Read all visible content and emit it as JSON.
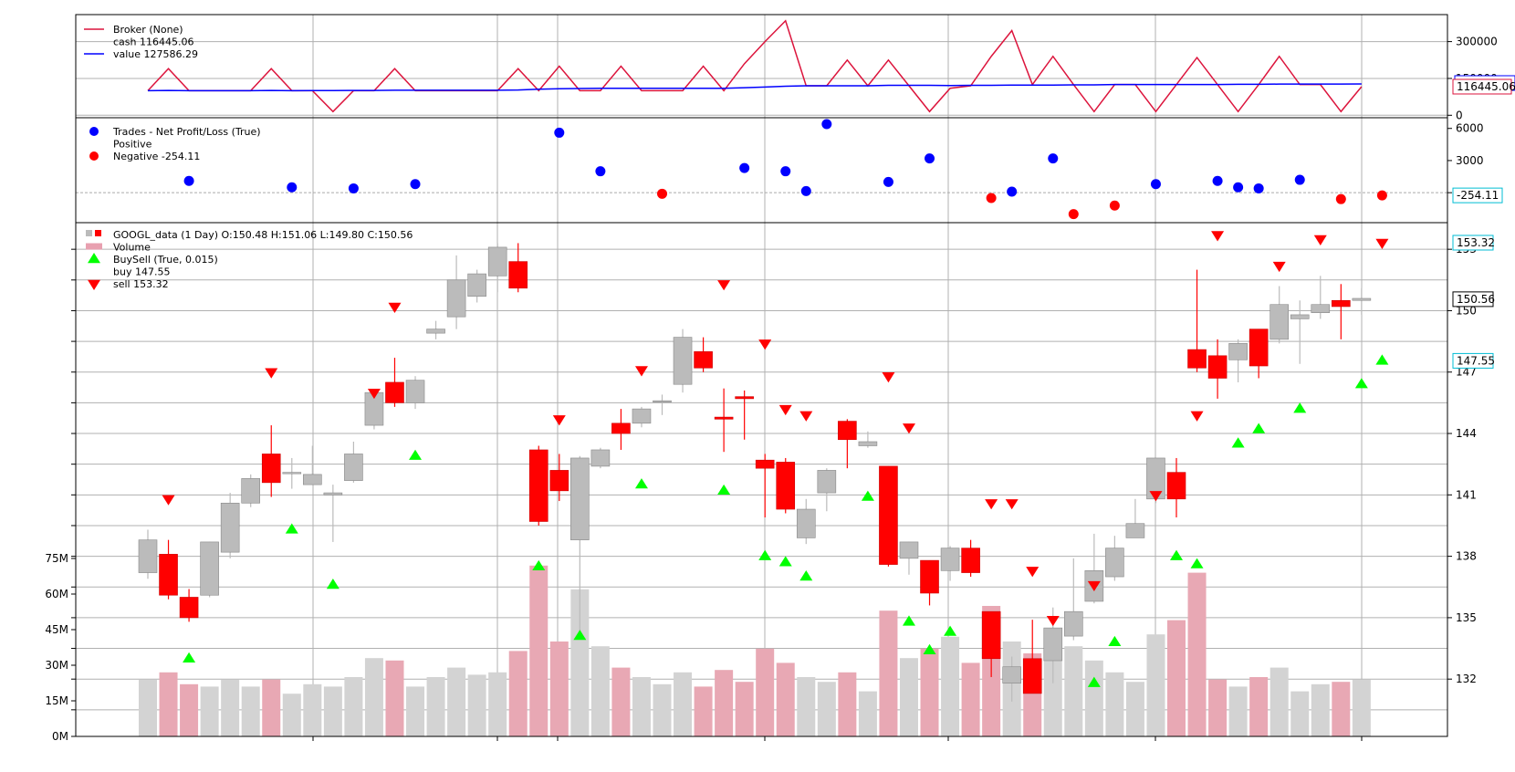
{
  "chart_data": [
    {
      "panel": "broker",
      "type": "line",
      "legend": {
        "title": "Broker (None)",
        "entries": [
          {
            "label": "cash 116445.06",
            "color": "#dc143c"
          },
          {
            "label": "value 127586.29",
            "color": "#0000ff"
          }
        ]
      },
      "yticks": [
        "0",
        "150000",
        "300000"
      ],
      "ylim": [
        -10000,
        410000
      ],
      "last_label": "116445.06",
      "cash": [
        100000,
        190000,
        100000,
        100000,
        100000,
        100000,
        190000,
        100000,
        100000,
        15000,
        100000,
        100000,
        190000,
        100000,
        100000,
        100000,
        100000,
        100000,
        190000,
        100000,
        200000,
        100000,
        100000,
        200000,
        100000,
        100000,
        100000,
        200000,
        100000,
        210000,
        300000,
        385000,
        120000,
        120000,
        225000,
        120000,
        225000,
        120000,
        15000,
        110000,
        120000,
        240000,
        345000,
        125000,
        240000,
        125000,
        15000,
        125000,
        125000,
        15000,
        125000,
        235000,
        125000,
        15000,
        125000,
        240000,
        125000,
        125000,
        15000,
        116445
      ],
      "value": [
        100000,
        101000,
        100000,
        100000,
        100000,
        100000,
        101000,
        100000,
        100500,
        100500,
        101000,
        101000,
        102000,
        102000,
        102000,
        102000,
        102000,
        102000,
        103000,
        106000,
        108000,
        109000,
        110000,
        110000,
        110000,
        110000,
        110000,
        110000,
        110000,
        112000,
        115000,
        118000,
        120000,
        120000,
        120000,
        120000,
        122000,
        122000,
        122000,
        121000,
        122000,
        122000,
        123000,
        123000,
        123000,
        124000,
        124000,
        125000,
        125000,
        125000,
        125000,
        125000,
        125000,
        126000,
        126000,
        127000,
        127000,
        127000,
        127000,
        127586
      ]
    },
    {
      "panel": "trades",
      "type": "scatter",
      "legend": {
        "title": "Trades - Net Profit/Loss (True)",
        "entries": [
          {
            "label": "Positive",
            "color": "#0000ff"
          },
          {
            "label": "Negative -254.11",
            "color": "#ff0000"
          }
        ]
      },
      "yticks": [
        "0",
        "3000",
        "6000"
      ],
      "ylim": [
        -2800,
        7000
      ],
      "last_label": "-254.11",
      "points": [
        {
          "i": 2,
          "v": 1100,
          "sign": "positive"
        },
        {
          "i": 7,
          "v": 500,
          "sign": "positive"
        },
        {
          "i": 10,
          "v": 400,
          "sign": "positive"
        },
        {
          "i": 13,
          "v": 800,
          "sign": "positive"
        },
        {
          "i": 20,
          "v": 5600,
          "sign": "positive"
        },
        {
          "i": 22,
          "v": 2000,
          "sign": "positive"
        },
        {
          "i": 25,
          "v": -100,
          "sign": "negative"
        },
        {
          "i": 29,
          "v": 2300,
          "sign": "positive"
        },
        {
          "i": 31,
          "v": 2000,
          "sign": "positive"
        },
        {
          "i": 32,
          "v": 150,
          "sign": "positive"
        },
        {
          "i": 33,
          "v": 6400,
          "sign": "positive"
        },
        {
          "i": 36,
          "v": 1000,
          "sign": "positive"
        },
        {
          "i": 38,
          "v": 3200,
          "sign": "positive"
        },
        {
          "i": 41,
          "v": -500,
          "sign": "negative"
        },
        {
          "i": 42,
          "v": 100,
          "sign": "positive"
        },
        {
          "i": 44,
          "v": 3200,
          "sign": "positive"
        },
        {
          "i": 45,
          "v": -2000,
          "sign": "negative"
        },
        {
          "i": 47,
          "v": -1200,
          "sign": "negative"
        },
        {
          "i": 49,
          "v": 800,
          "sign": "positive"
        },
        {
          "i": 52,
          "v": 1100,
          "sign": "positive"
        },
        {
          "i": 53,
          "v": 500,
          "sign": "positive"
        },
        {
          "i": 54,
          "v": 400,
          "sign": "positive"
        },
        {
          "i": 56,
          "v": 1200,
          "sign": "positive"
        },
        {
          "i": 58,
          "v": -600,
          "sign": "negative"
        },
        {
          "i": 60,
          "v": -254,
          "sign": "negative"
        }
      ]
    },
    {
      "panel": "price",
      "type": "candlestick",
      "legend": {
        "title": "GOOGL_data (1 Day) O:150.48 H:151.06 L:149.80 C:150.56",
        "entries": [
          {
            "label": "Volume",
            "color": "#e8a0b0"
          },
          {
            "label": "BuySell (True, 0.015)",
            "color": "#00ff00"
          },
          {
            "label": "buy 147.55",
            "color": "#00ff00"
          },
          {
            "label": "sell 153.32",
            "color": "#ff0000"
          }
        ]
      },
      "price_ticks": [
        "132",
        "135",
        "138",
        "141",
        "144",
        "147",
        "150",
        "153"
      ],
      "volume_ticks": [
        "0M",
        "15M",
        "30M",
        "45M",
        "60M",
        "75M"
      ],
      "price_ylim": [
        129.2,
        154.3
      ],
      "volume_max_m": 75,
      "price_labels": [
        "153.32",
        "150.56",
        "147.55"
      ],
      "candles": [
        {
          "o": 137.2,
          "h": 139.3,
          "l": 136.9,
          "c": 138.8
        },
        {
          "o": 138.1,
          "h": 138.8,
          "l": 135.9,
          "c": 136.1
        },
        {
          "o": 136.0,
          "h": 136.4,
          "l": 134.8,
          "c": 135.0
        },
        {
          "o": 136.1,
          "h": 138.7,
          "l": 136.0,
          "c": 138.7
        },
        {
          "o": 138.2,
          "h": 141.1,
          "l": 137.9,
          "c": 140.6
        },
        {
          "o": 140.6,
          "h": 142.0,
          "l": 140.4,
          "c": 141.8
        },
        {
          "o": 143.0,
          "h": 144.4,
          "l": 140.9,
          "c": 141.6
        },
        {
          "o": 142.1,
          "h": 142.8,
          "l": 141.3,
          "c": 142.1
        },
        {
          "o": 141.5,
          "h": 143.4,
          "l": 141.5,
          "c": 142.0
        },
        {
          "o": 141.0,
          "h": 141.5,
          "l": 138.7,
          "c": 141.1
        },
        {
          "o": 141.7,
          "h": 143.6,
          "l": 141.6,
          "c": 143.0
        },
        {
          "o": 144.4,
          "h": 146.1,
          "l": 144.2,
          "c": 146.0
        },
        {
          "o": 146.5,
          "h": 147.7,
          "l": 145.3,
          "c": 145.5
        },
        {
          "o": 145.5,
          "h": 146.8,
          "l": 145.2,
          "c": 146.6
        },
        {
          "o": 148.9,
          "h": 149.5,
          "l": 148.6,
          "c": 149.1
        },
        {
          "o": 149.7,
          "h": 152.7,
          "l": 149.1,
          "c": 151.5
        },
        {
          "o": 150.7,
          "h": 152.0,
          "l": 150.4,
          "c": 151.8
        },
        {
          "o": 151.7,
          "h": 153.3,
          "l": 150.9,
          "c": 153.1
        },
        {
          "o": 152.4,
          "h": 153.3,
          "l": 150.9,
          "c": 151.1
        },
        {
          "o": 143.2,
          "h": 143.4,
          "l": 139.5,
          "c": 139.7
        },
        {
          "o": 142.2,
          "h": 143.0,
          "l": 140.7,
          "c": 141.2
        },
        {
          "o": 138.8,
          "h": 142.9,
          "l": 134.1,
          "c": 142.8
        },
        {
          "o": 142.4,
          "h": 143.3,
          "l": 142.3,
          "c": 143.2
        },
        {
          "o": 144.5,
          "h": 145.2,
          "l": 143.2,
          "c": 144.0
        },
        {
          "o": 144.5,
          "h": 145.3,
          "l": 144.3,
          "c": 145.2
        },
        {
          "o": 145.6,
          "h": 145.9,
          "l": 144.9,
          "c": 145.6
        },
        {
          "o": 146.4,
          "h": 149.1,
          "l": 146.0,
          "c": 148.7
        },
        {
          "o": 148.0,
          "h": 148.7,
          "l": 147.0,
          "c": 147.2
        },
        {
          "o": 144.8,
          "h": 146.2,
          "l": 143.1,
          "c": 144.7
        },
        {
          "o": 145.8,
          "h": 146.1,
          "l": 143.7,
          "c": 145.7
        },
        {
          "o": 142.7,
          "h": 143.0,
          "l": 139.9,
          "c": 142.3
        },
        {
          "o": 142.6,
          "h": 142.8,
          "l": 140.1,
          "c": 140.3
        },
        {
          "o": 138.9,
          "h": 140.8,
          "l": 138.6,
          "c": 140.3
        },
        {
          "o": 141.1,
          "h": 142.3,
          "l": 140.2,
          "c": 142.2
        },
        {
          "o": 144.6,
          "h": 144.7,
          "l": 142.3,
          "c": 143.7
        },
        {
          "o": 143.4,
          "h": 144.1,
          "l": 143.3,
          "c": 143.6
        },
        {
          "o": 142.4,
          "h": 142.4,
          "l": 137.5,
          "c": 137.6
        },
        {
          "o": 137.9,
          "h": 138.7,
          "l": 137.1,
          "c": 138.7
        },
        {
          "o": 137.8,
          "h": 137.8,
          "l": 135.6,
          "c": 136.2
        },
        {
          "o": 137.3,
          "h": 138.5,
          "l": 136.8,
          "c": 138.4
        },
        {
          "o": 138.4,
          "h": 138.8,
          "l": 137.0,
          "c": 137.2
        },
        {
          "o": 135.3,
          "h": 135.3,
          "l": 132.1,
          "c": 133.0
        },
        {
          "o": 131.8,
          "h": 133.1,
          "l": 130.9,
          "c": 132.6
        },
        {
          "o": 133.0,
          "h": 134.9,
          "l": 131.5,
          "c": 131.3
        },
        {
          "o": 132.9,
          "h": 135.5,
          "l": 131.8,
          "c": 134.5
        },
        {
          "o": 134.1,
          "h": 137.9,
          "l": 133.9,
          "c": 135.3
        },
        {
          "o": 135.8,
          "h": 139.1,
          "l": 135.7,
          "c": 137.3
        },
        {
          "o": 137.0,
          "h": 139.0,
          "l": 136.8,
          "c": 138.4
        },
        {
          "o": 138.9,
          "h": 140.8,
          "l": 138.9,
          "c": 139.6
        },
        {
          "o": 140.8,
          "h": 142.8,
          "l": 140.6,
          "c": 142.8
        },
        {
          "o": 142.1,
          "h": 142.8,
          "l": 139.9,
          "c": 140.8
        },
        {
          "o": 148.1,
          "h": 152.0,
          "l": 147.0,
          "c": 147.2
        },
        {
          "o": 147.8,
          "h": 148.6,
          "l": 145.7,
          "c": 146.7
        },
        {
          "o": 147.6,
          "h": 148.6,
          "l": 146.5,
          "c": 148.4
        },
        {
          "o": 149.1,
          "h": 149.1,
          "l": 146.7,
          "c": 147.3
        },
        {
          "o": 148.6,
          "h": 151.2,
          "l": 148.4,
          "c": 150.3
        },
        {
          "o": 149.6,
          "h": 150.5,
          "l": 147.4,
          "c": 149.8
        },
        {
          "o": 149.9,
          "h": 151.7,
          "l": 149.6,
          "c": 150.3
        },
        {
          "o": 150.5,
          "h": 151.3,
          "l": 148.6,
          "c": 150.2
        },
        {
          "o": 150.5,
          "h": 151.1,
          "l": 149.8,
          "c": 150.6
        }
      ],
      "volume_m": [
        24,
        27,
        22,
        21,
        24,
        21,
        24,
        18,
        22,
        21,
        25,
        33,
        32,
        21,
        25,
        29,
        26,
        27,
        36,
        72,
        40,
        62,
        38,
        29,
        25,
        22,
        27,
        21,
        28,
        23,
        37,
        31,
        25,
        23,
        27,
        19,
        53,
        33,
        37,
        42,
        31,
        55,
        40,
        35,
        41,
        38,
        32,
        27,
        23,
        43,
        49,
        69,
        24,
        21,
        25,
        29,
        19,
        22,
        23,
        24
      ],
      "buys": [
        {
          "i": 2,
          "v": 133.0
        },
        {
          "i": 7,
          "v": 139.3
        },
        {
          "i": 9,
          "v": 136.6
        },
        {
          "i": 13,
          "v": 142.9
        },
        {
          "i": 19,
          "v": 137.5
        },
        {
          "i": 21,
          "v": 134.1
        },
        {
          "i": 24,
          "v": 141.5
        },
        {
          "i": 28,
          "v": 141.2
        },
        {
          "i": 30,
          "v": 138.0
        },
        {
          "i": 31,
          "v": 137.7
        },
        {
          "i": 32,
          "v": 137.0
        },
        {
          "i": 35,
          "v": 140.9
        },
        {
          "i": 37,
          "v": 134.8
        },
        {
          "i": 38,
          "v": 133.4
        },
        {
          "i": 39,
          "v": 134.3
        },
        {
          "i": 46,
          "v": 131.8
        },
        {
          "i": 47,
          "v": 133.8
        },
        {
          "i": 50,
          "v": 138.0
        },
        {
          "i": 51,
          "v": 137.6
        },
        {
          "i": 53,
          "v": 143.5
        },
        {
          "i": 54,
          "v": 144.2
        },
        {
          "i": 56,
          "v": 145.2
        },
        {
          "i": 59,
          "v": 146.4
        },
        {
          "i": 60,
          "v": 147.55
        }
      ],
      "sells": [
        {
          "i": 1,
          "v": 140.8
        },
        {
          "i": 6,
          "v": 147.0
        },
        {
          "i": 11,
          "v": 146.0
        },
        {
          "i": 12,
          "v": 150.2
        },
        {
          "i": 20,
          "v": 144.7
        },
        {
          "i": 24,
          "v": 147.1
        },
        {
          "i": 28,
          "v": 151.3
        },
        {
          "i": 30,
          "v": 148.4
        },
        {
          "i": 31,
          "v": 145.2
        },
        {
          "i": 32,
          "v": 144.9
        },
        {
          "i": 36,
          "v": 146.8
        },
        {
          "i": 37,
          "v": 144.3
        },
        {
          "i": 41,
          "v": 140.6
        },
        {
          "i": 42,
          "v": 140.6
        },
        {
          "i": 43,
          "v": 137.3
        },
        {
          "i": 44,
          "v": 134.9
        },
        {
          "i": 46,
          "v": 136.6
        },
        {
          "i": 49,
          "v": 141.0
        },
        {
          "i": 51,
          "v": 144.9
        },
        {
          "i": 52,
          "v": 153.7
        },
        {
          "i": 55,
          "v": 152.2
        },
        {
          "i": 57,
          "v": 153.5
        },
        {
          "i": 60,
          "v": 153.32
        }
      ]
    }
  ]
}
